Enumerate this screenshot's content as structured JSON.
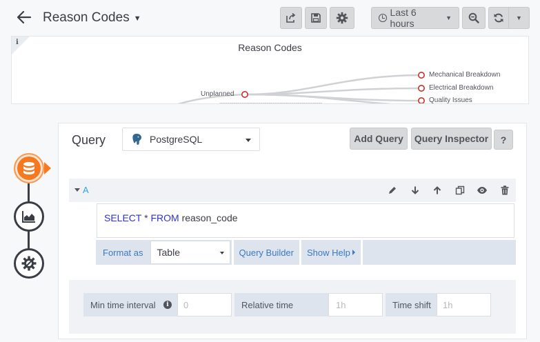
{
  "header": {
    "title": "Reason Codes",
    "time_range": "Last 6 hours"
  },
  "panel": {
    "title": "Reason Codes",
    "info_icon": "i",
    "source_node": "Unplanned",
    "target_nodes": [
      "Mechanical Breakdown",
      "Electrical Breakdown",
      "Quality Issues"
    ]
  },
  "editor": {
    "label": "Query",
    "datasource": "PostgreSQL",
    "add_query": "Add Query",
    "query_inspector": "Query Inspector",
    "help": "?",
    "query": {
      "ref_id": "A",
      "sql_select": "SELECT",
      "sql_star": "*",
      "sql_from": "FROM",
      "sql_table": "reason_code",
      "format_label": "Format as",
      "format_value": "Table",
      "query_builder": "Query Builder",
      "show_help": "Show Help"
    },
    "options": {
      "min_interval_label": "Min time interval",
      "min_interval_placeholder": "0",
      "relative_time_label": "Relative time",
      "relative_time_placeholder": "1h",
      "time_shift_label": "Time shift",
      "time_shift_placeholder": "1h"
    }
  },
  "colors": {
    "accent": "#f47920",
    "link": "#3a7abf",
    "node": "#c9302c"
  }
}
